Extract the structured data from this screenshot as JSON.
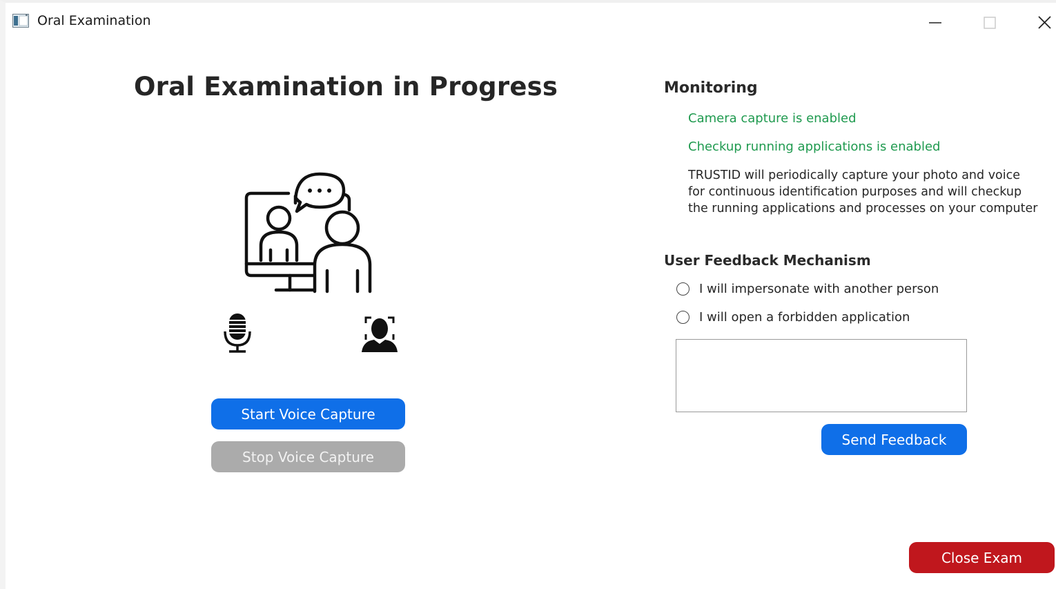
{
  "window": {
    "title": "Oral Examination",
    "controls": [
      "minimize",
      "maximize",
      "close"
    ]
  },
  "main": {
    "title": "Oral Examination in Progress",
    "illustration_icon": "video-call-illustration",
    "mic_icon": "microphone-icon",
    "face_icon": "face-scan-icon",
    "start_voice_label": "Start Voice Capture",
    "stop_voice_label": "Stop Voice Capture"
  },
  "monitoring": {
    "heading": "Monitoring",
    "camera_status": "Camera capture is enabled",
    "apps_status": "Checkup running applications is enabled",
    "info_lines": [
      "TRUSTID will periodically capture your photo and voice",
      "for continuous identification purposes and will checkup",
      "the running applications and processes on your computer"
    ]
  },
  "feedback": {
    "heading": "User Feedback Mechanism",
    "options": [
      "I will impersonate with another person",
      "I will open a forbidden application"
    ],
    "selected_option": null,
    "text_value": "",
    "send_label": "Send Feedback"
  },
  "footer": {
    "close_exam_label": "Close Exam"
  },
  "colors": {
    "primary_button": "#0f6fe8",
    "disabled_button": "#ababab",
    "danger_button": "#c0171d",
    "status_green": "#1f9a4f"
  }
}
